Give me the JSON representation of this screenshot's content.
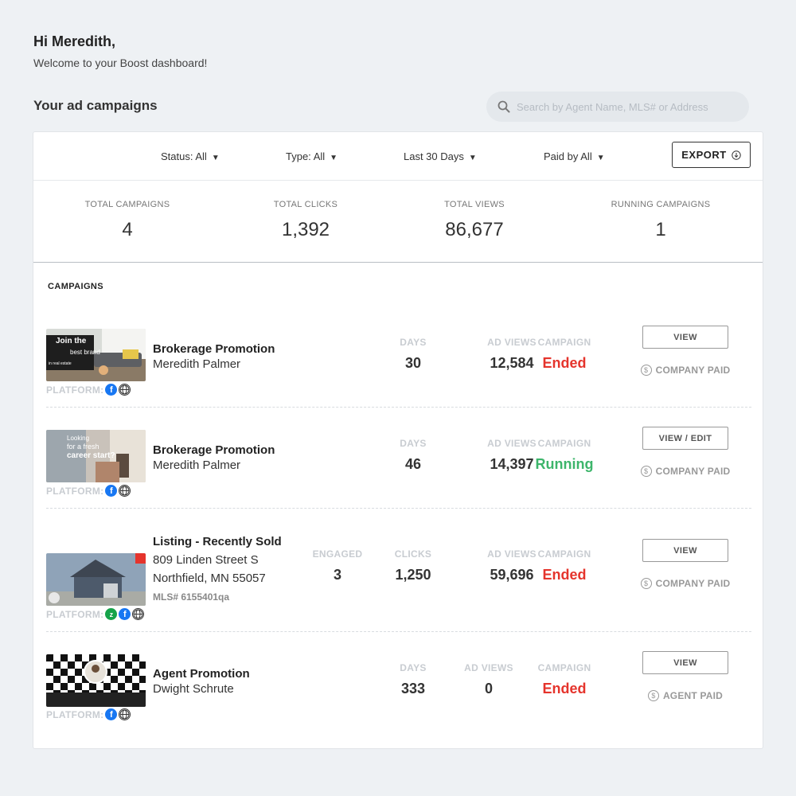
{
  "header": {
    "greeting": "Hi Meredith,",
    "welcome": "Welcome to your Boost dashboard!"
  },
  "section_title": "Your ad campaigns",
  "search": {
    "placeholder": "Search by Agent Name, MLS# or Address",
    "icon": "search-icon"
  },
  "filters": {
    "status": "Status: All",
    "type": "Type: All",
    "date": "Last 30 Days",
    "paid_by": "Paid by All",
    "caret": "▼",
    "export_label": "EXPORT"
  },
  "stats": [
    {
      "label": "TOTAL CAMPAIGNS",
      "value": "4"
    },
    {
      "label": "TOTAL CLICKS",
      "value": "1,392"
    },
    {
      "label": "TOTAL VIEWS",
      "value": "86,677"
    },
    {
      "label": "RUNNING CAMPAIGNS",
      "value": "1"
    }
  ],
  "campaigns_heading": "CAMPAIGNS",
  "platform_label": "PLATFORM:",
  "campaigns": [
    {
      "title": "Brokerage Promotion",
      "line1": "Meredith Palmer",
      "thumb_text": [
        "Join the",
        "best brand",
        "in real estate"
      ],
      "platforms": [
        "facebook-icon",
        "globe-icon"
      ],
      "metrics": [
        {
          "label": "DAYS",
          "value": "30"
        },
        {
          "label": "AD VIEWS",
          "value": "12,584"
        },
        {
          "label": "CAMPAIGN",
          "value": "Ended"
        }
      ],
      "button": "VIEW",
      "paid": "COMPANY PAID"
    },
    {
      "title": "Brokerage Promotion",
      "line1": "Meredith Palmer",
      "thumb_text": [
        "Looking",
        "for a fresh",
        "career start?"
      ],
      "platforms": [
        "facebook-icon",
        "globe-icon"
      ],
      "metrics": [
        {
          "label": "DAYS",
          "value": "46"
        },
        {
          "label": "AD VIEWS",
          "value": "14,397"
        },
        {
          "label": "CAMPAIGN",
          "value": "Running"
        }
      ],
      "button": "VIEW / EDIT",
      "paid": "COMPANY PAID"
    },
    {
      "title": "Listing - Recently Sold",
      "line1": "809 Linden Street S",
      "line2": "Northfield, MN 55057",
      "mls": "MLS# 6155401qa",
      "platforms": [
        "zillow-icon",
        "facebook-icon",
        "globe-icon"
      ],
      "metrics": [
        {
          "label": "ENGAGED",
          "value": "3"
        },
        {
          "label": "CLICKS",
          "value": "1,250"
        },
        {
          "label": "AD VIEWS",
          "value": "59,696"
        },
        {
          "label": "CAMPAIGN",
          "value": "Ended"
        }
      ],
      "button": "VIEW",
      "paid": "COMPANY PAID"
    },
    {
      "title": "Agent Promotion",
      "line1": "Dwight Schrute",
      "platforms": [
        "facebook-icon",
        "globe-icon"
      ],
      "metrics": [
        {
          "label": "DAYS",
          "value": "333"
        },
        {
          "label": "AD VIEWS",
          "value": "0"
        },
        {
          "label": "CAMPAIGN",
          "value": "Ended"
        }
      ],
      "button": "VIEW",
      "paid": "AGENT PAID"
    }
  ],
  "colors": {
    "ended": "#e5342c",
    "running": "#3db56b",
    "facebook": "#1877f2",
    "background": "#eef1f4"
  }
}
